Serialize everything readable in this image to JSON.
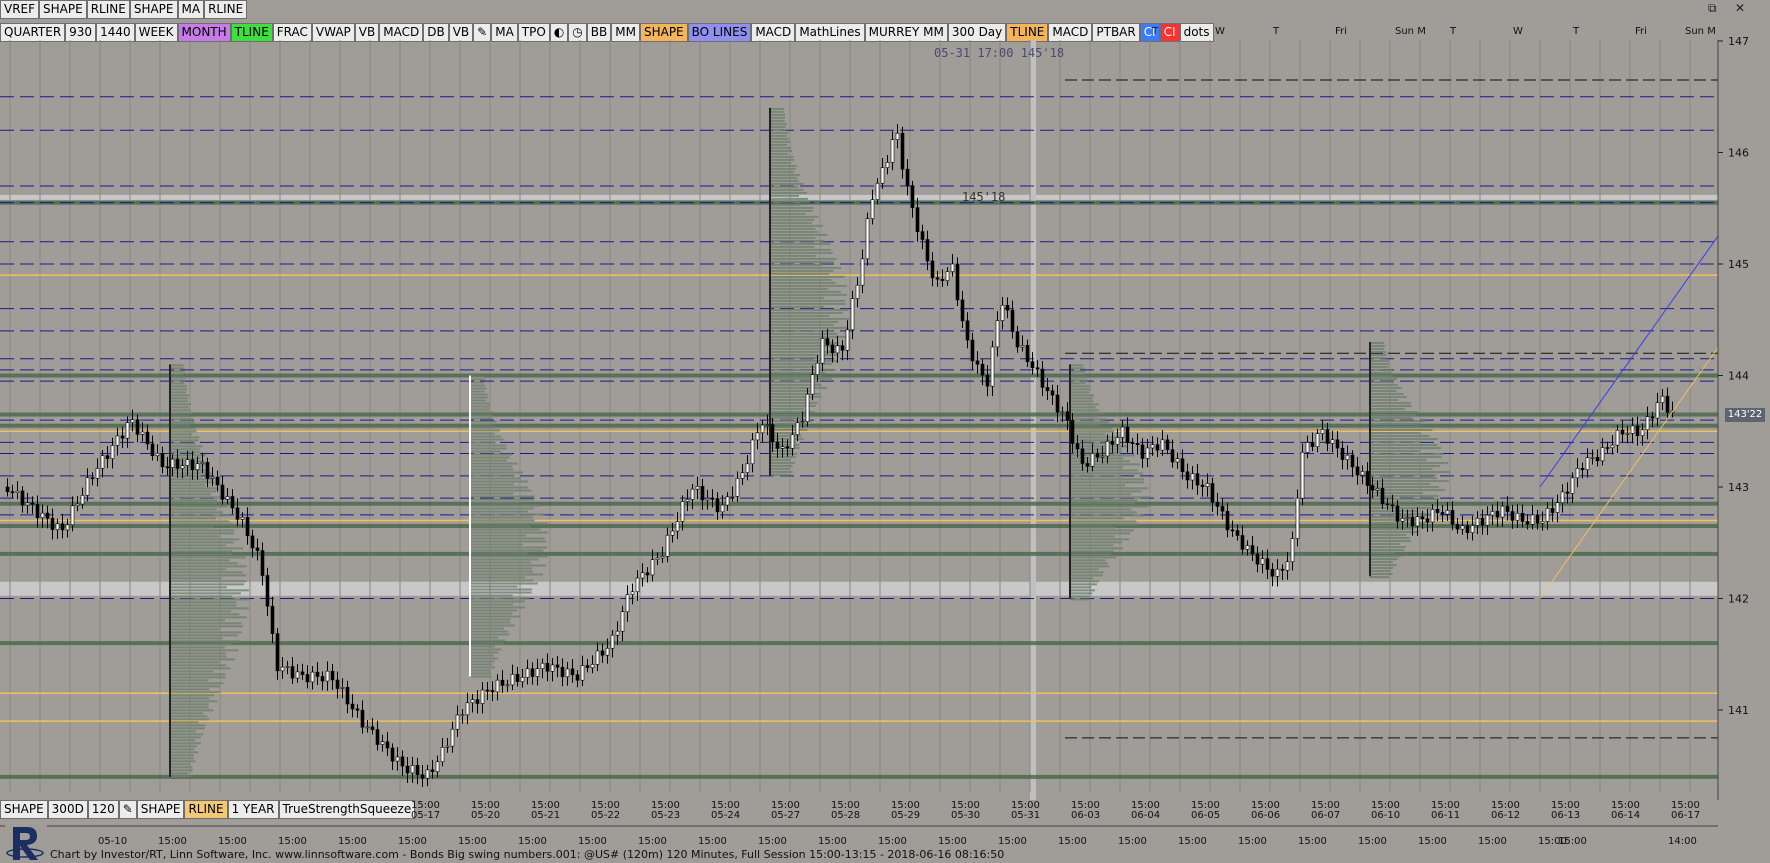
{
  "toolbar_top": [
    "VREF",
    "SHAPE",
    "RLINE",
    "SHAPE",
    "MA",
    "RLINE"
  ],
  "toolbar_second": [
    {
      "label": "QUARTER",
      "bg": "#ececec"
    },
    {
      "label": "930",
      "bg": "#ececec"
    },
    {
      "label": "1440",
      "bg": "#ececec"
    },
    {
      "label": "WEEK",
      "bg": "#ececec"
    },
    {
      "label": "MONTH",
      "bg": "#c77be8"
    },
    {
      "label": "TLINE",
      "bg": "#3de03d"
    },
    {
      "label": "FRAC",
      "bg": "#ececec"
    },
    {
      "label": "VWAP",
      "bg": "#ececec"
    },
    {
      "label": "VB",
      "bg": "#ececec"
    },
    {
      "label": "MACD",
      "bg": "#ececec"
    },
    {
      "label": "DB",
      "bg": "#ececec"
    },
    {
      "label": "VB",
      "bg": "#ececec"
    },
    {
      "label": "pencil-icon",
      "bg": "#ececec",
      "icon": true
    },
    {
      "label": "MA",
      "bg": "#ececec"
    },
    {
      "label": "TPO",
      "bg": "#ececec"
    },
    {
      "label": "cycle-icon",
      "bg": "#ececec",
      "icon": true
    },
    {
      "label": "clock-icon",
      "bg": "#ececec",
      "icon": true
    },
    {
      "label": "BB",
      "bg": "#ececec"
    },
    {
      "label": "MM",
      "bg": "#ececec"
    },
    {
      "label": "SHAPE",
      "bg": "#f3b45a"
    },
    {
      "label": "BO LINES",
      "bg": "#8f8ff0"
    },
    {
      "label": "MACD",
      "bg": "#ececec"
    },
    {
      "label": "MathLines",
      "bg": "#ececec"
    },
    {
      "label": "MURREY MM",
      "bg": "#ececec"
    },
    {
      "label": "300 Day",
      "bg": "#ececec"
    },
    {
      "label": "TLINE",
      "bg": "#f3b45a"
    },
    {
      "label": "MACD",
      "bg": "#ececec"
    },
    {
      "label": "PTBAR",
      "bg": "#ececec"
    },
    {
      "label": "CI",
      "bg": "#3a7bff"
    },
    {
      "label": "CI",
      "bg": "#ff3030"
    },
    {
      "label": "dots",
      "bg": "#ececec"
    }
  ],
  "toolbar_bottom": [
    {
      "label": "SHAPE",
      "bg": "#ececec"
    },
    {
      "label": "300D",
      "bg": "#ececec"
    },
    {
      "label": "120",
      "bg": "#ececec"
    },
    {
      "label": "pencil-icon",
      "bg": "#ececec",
      "icon": true
    },
    {
      "label": "SHAPE",
      "bg": "#ececec"
    },
    {
      "label": "RLINE",
      "bg": "#f3c875"
    },
    {
      "label": "1 YEAR",
      "bg": "#ececec"
    },
    {
      "label": "TrueStrengthSqueeze",
      "bg": "#ececec"
    }
  ],
  "cursor_readout": "05-31  17:00  145'18",
  "price_label_chart": "145'18",
  "last_price_tag": "143'22",
  "y_axis_labels": [
    "147",
    "146",
    "145",
    "144",
    "143",
    "142",
    "141"
  ],
  "top_day_labels": [
    "T",
    "W",
    "T",
    "Fri",
    "Sun M",
    "T",
    "W",
    "T",
    "Fri",
    "Sun M"
  ],
  "session_dates": [
    "05-17",
    "05-20",
    "05-21",
    "05-22",
    "05-23",
    "05-24",
    "05-27",
    "05-28",
    "05-29",
    "05-30",
    "05-31",
    "06-03",
    "06-04",
    "06-05",
    "06-06",
    "06-07",
    "06-10",
    "06-11",
    "06-12",
    "06-13",
    "06-14",
    "06-17"
  ],
  "session_time_label": "15:00",
  "bottom_axis_labels": [
    "05-10",
    "15:00",
    "15:00",
    "15:00",
    "15:00",
    "15:00",
    "15:00",
    "15:00",
    "15:00",
    "15:00",
    "15:00",
    "15:00",
    "15:00",
    "15:00",
    "15:00",
    "15:00",
    "15:00",
    "15:00",
    "15:00",
    "15:00",
    "15:00",
    "15:00",
    "15:00",
    "15:00",
    "15:00",
    "15:00",
    "14:00"
  ],
  "footer": "Chart by Investor/RT, Linn Software, Inc. www.linnsoftware.com - Bonds Big swing numbers.001: @US# (120m) 120 Minutes, Full Session 15:00-13:15 - 2018-06-16 08:16:50",
  "colors": {
    "background": "#a09c98",
    "navy_line": "#1a1a8a",
    "orange_line": "#f0c060",
    "green_level": "#4d6a4d",
    "candle_up": "#ffffff",
    "candle_down": "#000000"
  },
  "chart_data": {
    "type": "candlestick",
    "y_range": [
      140.7,
      147.2
    ],
    "price_y": [
      {
        "p": 147,
        "y": 41
      },
      {
        "p": 141,
        "y": 710
      }
    ],
    "blue_levels": [
      146.5,
      146.2,
      145.7,
      145.55,
      145.2,
      145.0,
      144.6,
      144.4,
      144.15,
      144.05,
      143.95,
      143.6,
      143.4,
      143.3,
      143.1,
      142.9,
      142.75,
      142.0
    ],
    "orange_levels": [
      144.9,
      143.5,
      142.7,
      141.15,
      140.9
    ],
    "black_dash_levels": [
      146.65,
      144.2,
      140.75
    ],
    "green_levels": [
      145.55,
      144.0,
      143.65,
      143.55,
      142.85,
      142.65,
      142.4,
      141.6,
      140.4
    ],
    "ohlc": []
  }
}
